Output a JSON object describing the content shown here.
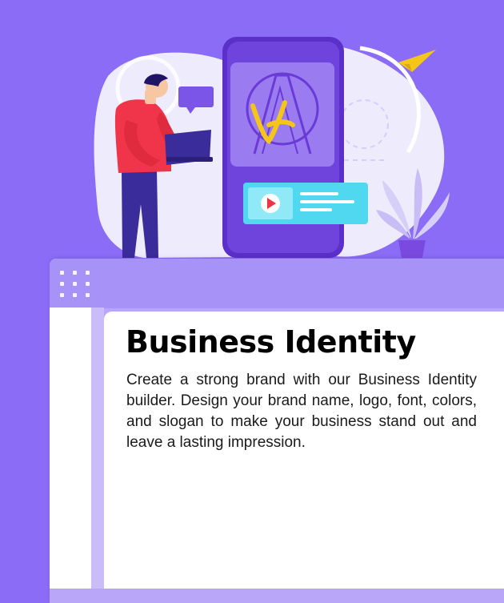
{
  "hero": {
    "illustration": "person-with-laptop-beside-phone-logo-design-illustration",
    "icons": [
      "paper-plane-icon",
      "play-icon",
      "plant-icon",
      "chat-bubble-icon"
    ],
    "colors": {
      "background": "#8b6cf6",
      "phone": "#6a3ad6",
      "accent_yellow": "#f5c518",
      "accent_cyan": "#4fd8ef"
    }
  },
  "card": {
    "title": "Business Identity",
    "description": "Create a strong brand with our Business Identity builder. Design your brand name, logo, font, colors, and slogan to make your business stand out and leave a lasting impression."
  }
}
